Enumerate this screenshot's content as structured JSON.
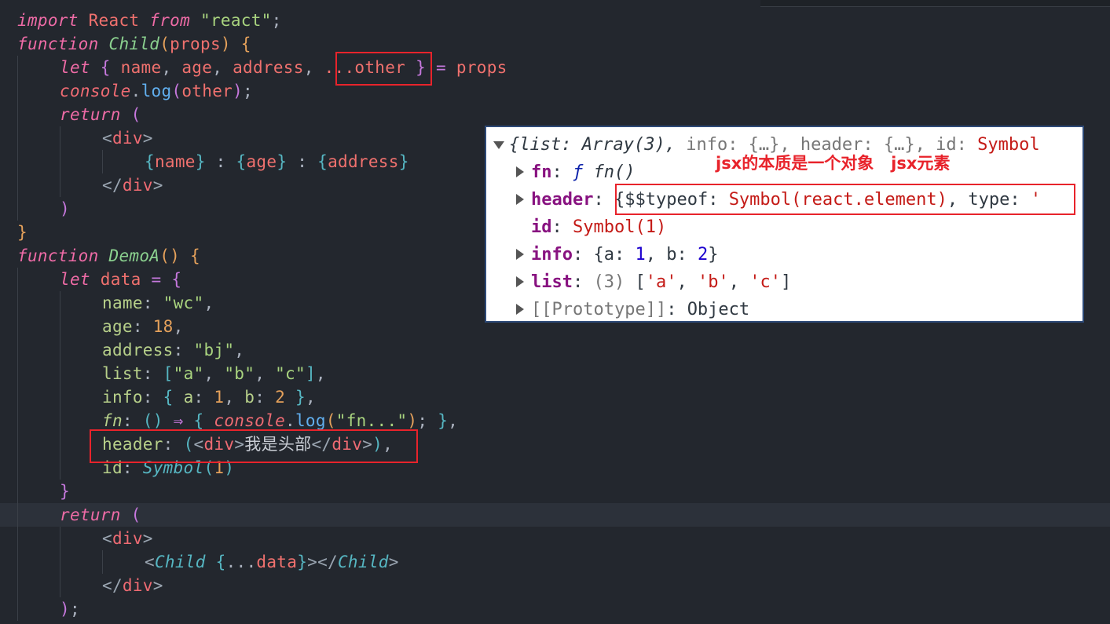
{
  "editor": {
    "current_line": 22,
    "lines": [
      {
        "indent": 0,
        "tokens": [
          [
            "import ",
            "k"
          ],
          [
            "React ",
            "v"
          ],
          [
            "from ",
            "k"
          ],
          [
            "\"react\"",
            "s"
          ],
          [
            ";",
            "w"
          ]
        ]
      },
      {
        "indent": 0,
        "tokens": [
          [
            "function ",
            "k"
          ],
          [
            "Child",
            "fi"
          ],
          [
            "(",
            "b1"
          ],
          [
            "props",
            "v"
          ],
          [
            ") ",
            "b1"
          ],
          [
            "{",
            "b1"
          ]
        ]
      },
      {
        "indent": 1,
        "tokens": [
          [
            "let ",
            "k"
          ],
          [
            "{ ",
            "b2"
          ],
          [
            "name",
            "v"
          ],
          [
            ", ",
            "w"
          ],
          [
            "age",
            "v"
          ],
          [
            ", ",
            "w"
          ],
          [
            "address",
            "v"
          ],
          [
            ", ",
            "w"
          ],
          [
            "...other ",
            "v"
          ],
          [
            "}",
            "b2"
          ],
          [
            " = ",
            "o"
          ],
          [
            "props",
            "v"
          ]
        ]
      },
      {
        "indent": 1,
        "tokens": [
          [
            "console",
            "c"
          ],
          [
            ".",
            "w"
          ],
          [
            "log",
            "m"
          ],
          [
            "(",
            "b2"
          ],
          [
            "other",
            "v"
          ],
          [
            ")",
            "b2"
          ],
          [
            ";",
            "w"
          ]
        ]
      },
      {
        "indent": 1,
        "tokens": [
          [
            "return ",
            "k"
          ],
          [
            "(",
            "b2"
          ]
        ]
      },
      {
        "indent": 2,
        "tokens": [
          [
            "<",
            "t"
          ],
          [
            "div",
            "tg"
          ],
          [
            ">",
            "t"
          ]
        ]
      },
      {
        "indent": 3,
        "tokens": [
          [
            "{",
            "b3"
          ],
          [
            "name",
            "v"
          ],
          [
            "}",
            "b3"
          ],
          [
            " : ",
            "w"
          ],
          [
            "{",
            "b3"
          ],
          [
            "age",
            "v"
          ],
          [
            "}",
            "b3"
          ],
          [
            " : ",
            "w"
          ],
          [
            "{",
            "b3"
          ],
          [
            "address",
            "v"
          ],
          [
            "}",
            "b3"
          ]
        ]
      },
      {
        "indent": 2,
        "tokens": [
          [
            "</",
            "t"
          ],
          [
            "div",
            "tg"
          ],
          [
            ">",
            "t"
          ]
        ]
      },
      {
        "indent": 1,
        "tokens": [
          [
            ")",
            "b2"
          ]
        ]
      },
      {
        "indent": 0,
        "tokens": [
          [
            "}",
            "b1"
          ]
        ]
      },
      {
        "indent": 0,
        "tokens": [
          [
            "function ",
            "k"
          ],
          [
            "DemoA",
            "fi"
          ],
          [
            "()",
            "b1"
          ],
          [
            " {",
            "b1"
          ]
        ]
      },
      {
        "indent": 1,
        "tokens": [
          [
            "let ",
            "k"
          ],
          [
            "data",
            "v"
          ],
          [
            " = ",
            "o"
          ],
          [
            "{",
            "b2"
          ]
        ]
      },
      {
        "indent": 2,
        "tokens": [
          [
            "name",
            "p"
          ],
          [
            ": ",
            "w"
          ],
          [
            "\"wc\"",
            "s"
          ],
          [
            ",",
            "w"
          ]
        ]
      },
      {
        "indent": 2,
        "tokens": [
          [
            "age",
            "p"
          ],
          [
            ": ",
            "w"
          ],
          [
            "18",
            "n"
          ],
          [
            ",",
            "w"
          ]
        ]
      },
      {
        "indent": 2,
        "tokens": [
          [
            "address",
            "p"
          ],
          [
            ": ",
            "w"
          ],
          [
            "\"bj\"",
            "s"
          ],
          [
            ",",
            "w"
          ]
        ]
      },
      {
        "indent": 2,
        "tokens": [
          [
            "list",
            "p"
          ],
          [
            ": ",
            "w"
          ],
          [
            "[",
            "b3"
          ],
          [
            "\"a\"",
            "s"
          ],
          [
            ", ",
            "w"
          ],
          [
            "\"b\"",
            "s"
          ],
          [
            ", ",
            "w"
          ],
          [
            "\"c\"",
            "s"
          ],
          [
            "]",
            "b3"
          ],
          [
            ",",
            "w"
          ]
        ]
      },
      {
        "indent": 2,
        "tokens": [
          [
            "info",
            "p"
          ],
          [
            ": ",
            "w"
          ],
          [
            "{ ",
            "b3"
          ],
          [
            "a",
            "p"
          ],
          [
            ": ",
            "w"
          ],
          [
            "1",
            "n"
          ],
          [
            ", ",
            "w"
          ],
          [
            "b",
            "p"
          ],
          [
            ": ",
            "w"
          ],
          [
            "2",
            "n"
          ],
          [
            " }",
            "b3"
          ],
          [
            ",",
            "w"
          ]
        ]
      },
      {
        "indent": 2,
        "tokens": [
          [
            "fn",
            "pi"
          ],
          [
            ": ",
            "w"
          ],
          [
            "()",
            "b3"
          ],
          [
            " ⇒ ",
            "o"
          ],
          [
            "{ ",
            "b3"
          ],
          [
            "console",
            "c"
          ],
          [
            ".",
            "w"
          ],
          [
            "log",
            "m"
          ],
          [
            "(",
            "b1"
          ],
          [
            "\"fn...\"",
            "s"
          ],
          [
            ")",
            "b1"
          ],
          [
            "; ",
            "w"
          ],
          [
            "}",
            "b3"
          ],
          [
            ",",
            "w"
          ]
        ]
      },
      {
        "indent": 2,
        "tokens": [
          [
            "header",
            "p"
          ],
          [
            ": ",
            "w"
          ],
          [
            "(",
            "b3"
          ],
          [
            "<",
            "t"
          ],
          [
            "div",
            "tg"
          ],
          [
            ">",
            "t"
          ],
          [
            "我是头部",
            "cn"
          ],
          [
            "</",
            "t"
          ],
          [
            "div",
            "tg"
          ],
          [
            ">",
            "t"
          ],
          [
            ")",
            "b3"
          ],
          [
            ",",
            "w"
          ]
        ]
      },
      {
        "indent": 2,
        "tokens": [
          [
            "id",
            "p"
          ],
          [
            ": ",
            "w"
          ],
          [
            "Symbol",
            "cls"
          ],
          [
            "(",
            "b3"
          ],
          [
            "1",
            "n"
          ],
          [
            ")",
            "b3"
          ]
        ]
      },
      {
        "indent": 1,
        "tokens": [
          [
            "}",
            "b2"
          ]
        ]
      },
      {
        "indent": 1,
        "tokens": [
          [
            "return ",
            "k"
          ],
          [
            "(",
            "b2"
          ]
        ]
      },
      {
        "indent": 2,
        "tokens": [
          [
            "<",
            "t"
          ],
          [
            "div",
            "tg"
          ],
          [
            ">",
            "t"
          ]
        ]
      },
      {
        "indent": 3,
        "tokens": [
          [
            "<",
            "t"
          ],
          [
            "Child",
            "cls"
          ],
          [
            " {",
            "b3"
          ],
          [
            "...",
            "w"
          ],
          [
            "data",
            "v"
          ],
          [
            "}",
            "b3"
          ],
          [
            ">",
            "t"
          ],
          [
            "</",
            "t"
          ],
          [
            "Child",
            "cls"
          ],
          [
            ">",
            "t"
          ]
        ]
      },
      {
        "indent": 2,
        "tokens": [
          [
            "</",
            "t"
          ],
          [
            "div",
            "tg"
          ],
          [
            ">",
            "t"
          ]
        ]
      },
      {
        "indent": 1,
        "tokens": [
          [
            ")",
            "b2"
          ],
          [
            ";",
            "w"
          ]
        ]
      }
    ]
  },
  "console": {
    "annotation": "jsx的本质是一个对象   jsx元素",
    "lines": [
      {
        "arrow": "down",
        "indent": 0,
        "tokens": [
          [
            "{",
            "cgi"
          ],
          [
            "list",
            "cgi"
          ],
          [
            ": ",
            "cgi"
          ],
          [
            "Array(3)",
            "cgi"
          ],
          [
            ", ",
            "cgi"
          ],
          [
            "info",
            "cdim"
          ],
          [
            ": {…}, ",
            "cdim"
          ],
          [
            "header",
            "cdim"
          ],
          [
            ": {…}, ",
            "cdim"
          ],
          [
            "id",
            "cdim"
          ],
          [
            ": ",
            "cdim"
          ],
          [
            "Symbol",
            "cs"
          ]
        ]
      },
      {
        "arrow": "right",
        "indent": 1,
        "tokens": [
          [
            "fn",
            "ck"
          ],
          [
            ": ",
            "cg"
          ],
          [
            "ƒ ",
            "cfi"
          ],
          [
            "fn()",
            "cgi"
          ]
        ]
      },
      {
        "arrow": "right",
        "indent": 1,
        "tokens": [
          [
            "header",
            "ck"
          ],
          [
            ": ",
            "cg"
          ],
          [
            "{$$typeof: ",
            "cg"
          ],
          [
            "Symbol(react.element)",
            "cs"
          ],
          [
            ", type: ",
            "cg"
          ],
          [
            "'",
            "cs"
          ]
        ]
      },
      {
        "arrow": "none",
        "indent": 1,
        "tokens": [
          [
            "id",
            "ck"
          ],
          [
            ": ",
            "cg"
          ],
          [
            "Symbol(1)",
            "cs"
          ]
        ]
      },
      {
        "arrow": "right",
        "indent": 1,
        "tokens": [
          [
            "info",
            "ck"
          ],
          [
            ": ",
            "cg"
          ],
          [
            "{a: ",
            "cg"
          ],
          [
            "1",
            "cnum"
          ],
          [
            ", b: ",
            "cg"
          ],
          [
            "2",
            "cnum"
          ],
          [
            "}",
            "cg"
          ]
        ]
      },
      {
        "arrow": "right",
        "indent": 1,
        "tokens": [
          [
            "list",
            "ck"
          ],
          [
            ": ",
            "cg"
          ],
          [
            "(3) ",
            "cdim"
          ],
          [
            "[",
            "cg"
          ],
          [
            "'a'",
            "cs"
          ],
          [
            ", ",
            "cg"
          ],
          [
            "'b'",
            "cs"
          ],
          [
            ", ",
            "cg"
          ],
          [
            "'c'",
            "cs"
          ],
          [
            "]",
            "cg"
          ]
        ]
      },
      {
        "arrow": "right",
        "indent": 1,
        "tokens": [
          [
            "[[Prototype]]",
            "cdim"
          ],
          [
            ": ",
            "cg"
          ],
          [
            "Object",
            "cg"
          ]
        ]
      }
    ]
  },
  "colors": {
    "background": "#23272e",
    "highlight": "#e8232b",
    "console_border": "#2e4a78"
  }
}
